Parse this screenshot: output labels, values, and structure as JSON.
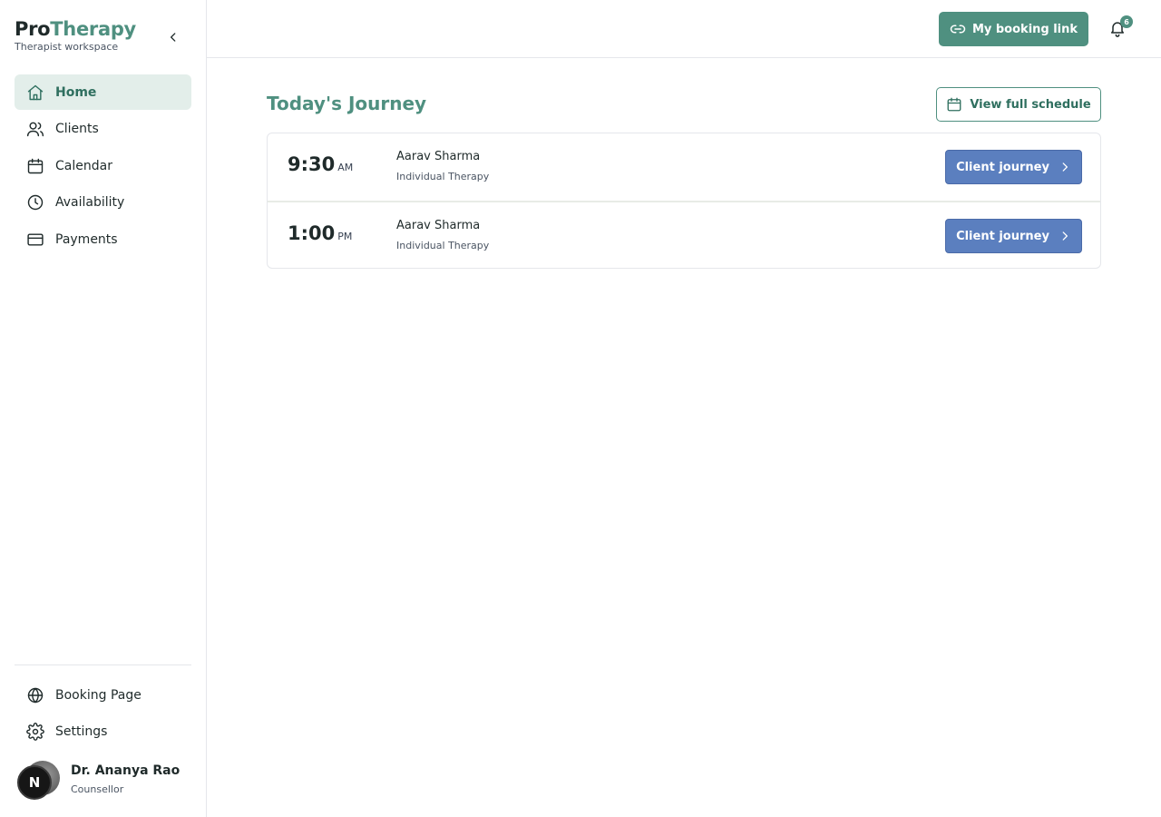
{
  "brand": {
    "name_part1": "Pro",
    "name_part2": "Therapy",
    "subtitle": "Therapist workspace"
  },
  "sidebar": {
    "items": [
      {
        "label": "Home",
        "icon": "home-icon",
        "active": true
      },
      {
        "label": "Clients",
        "icon": "users-icon"
      },
      {
        "label": "Calendar",
        "icon": "calendar-icon"
      },
      {
        "label": "Availability",
        "icon": "clock-icon"
      },
      {
        "label": "Payments",
        "icon": "credit-card-icon"
      }
    ],
    "bottom_items": [
      {
        "label": "Booking Page",
        "icon": "globe-icon"
      },
      {
        "label": "Settings",
        "icon": "gear-icon"
      }
    ],
    "user": {
      "name": "Dr. Ananya Rao",
      "role": "Counsellor",
      "badge": "N"
    }
  },
  "header": {
    "booking_link_label": "My booking link",
    "notification_count": "6"
  },
  "main": {
    "title": "Today's Journey",
    "schedule_button": "View full schedule",
    "appointments": [
      {
        "time": "9:30",
        "period": "AM",
        "client": "Aarav Sharma",
        "type": "Individual Therapy",
        "action": "Client journey"
      },
      {
        "time": "1:00",
        "period": "PM",
        "client": "Aarav Sharma",
        "type": "Individual Therapy",
        "action": "Client journey"
      }
    ]
  },
  "colors": {
    "accent": "#4f9080",
    "active_bg": "#e3eeea",
    "journey_button": "#5b7fbf"
  }
}
